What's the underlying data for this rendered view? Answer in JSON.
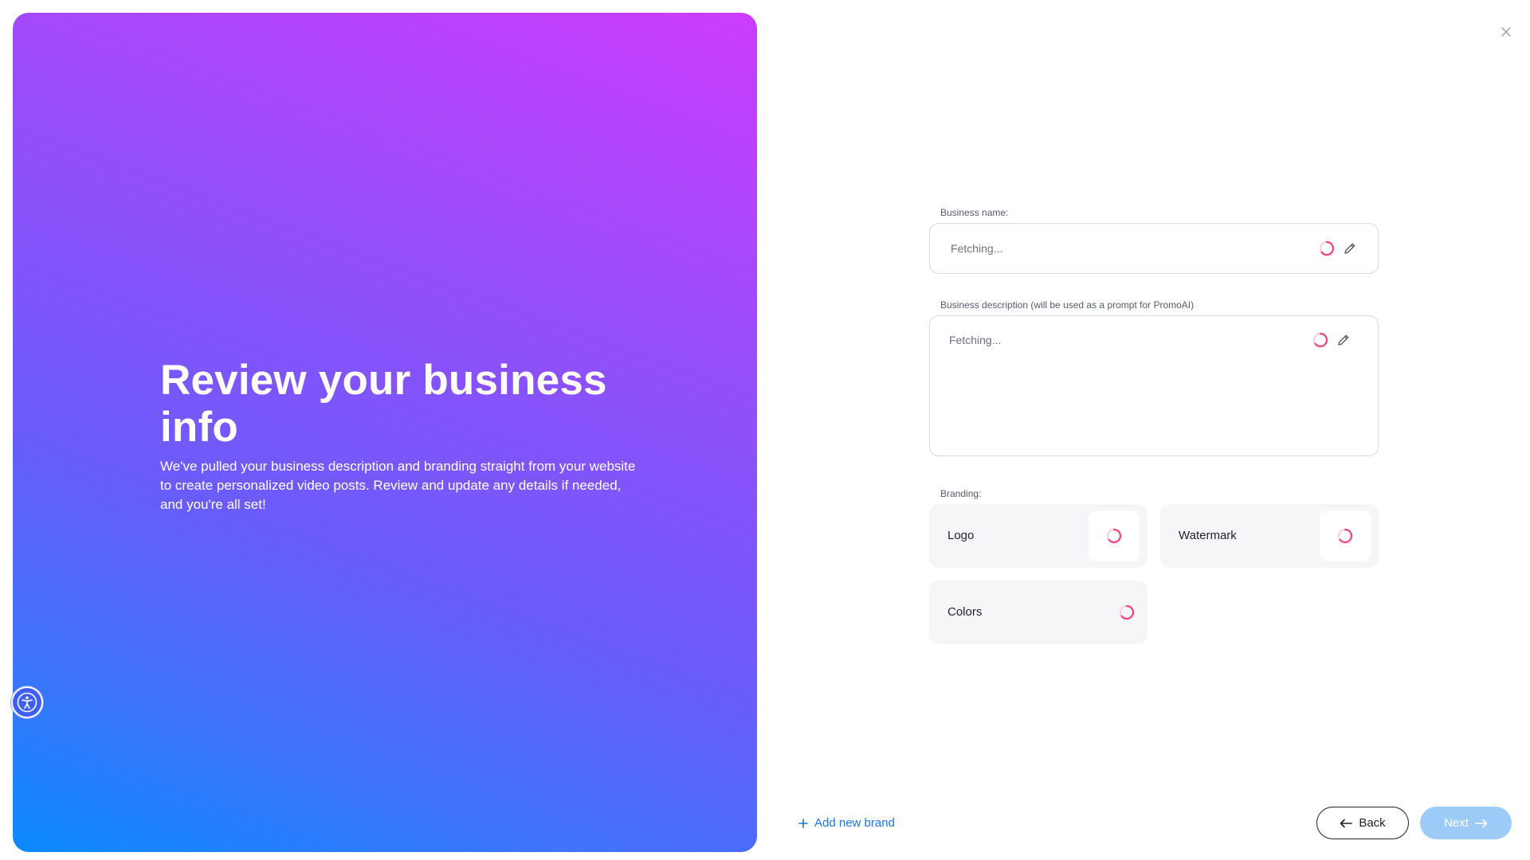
{
  "hero": {
    "title": "Review your business info",
    "subtitle": "We've pulled your business description and branding straight from your website to create personalized video posts. Review and update any details if needed, and you're all set!"
  },
  "form": {
    "business_name": {
      "label": "Business name:",
      "value": "Fetching..."
    },
    "business_description": {
      "label": "Business description (will be used as a prompt for PromoAI)",
      "value": "Fetching..."
    },
    "branding": {
      "label": "Branding:",
      "items": [
        {
          "label": "Logo"
        },
        {
          "label": "Watermark"
        },
        {
          "label": "Colors"
        }
      ]
    }
  },
  "footer": {
    "add_brand_label": "Add new brand",
    "back_label": "Back",
    "next_label": "Next"
  },
  "icons": {
    "close": "close-icon",
    "edit": "pencil-icon",
    "loading": "spinner-icon",
    "accessibility": "accessibility-icon",
    "add": "plus-icon",
    "back": "arrow-left-icon",
    "next": "arrow-right-icon"
  },
  "colors": {
    "accent_blue": "#1a73e8",
    "spinner": "#f0447a",
    "next_disabled": "#9ccbf8",
    "gradient_top": "#cc3cfc",
    "gradient_bottom": "#0a8aff"
  }
}
